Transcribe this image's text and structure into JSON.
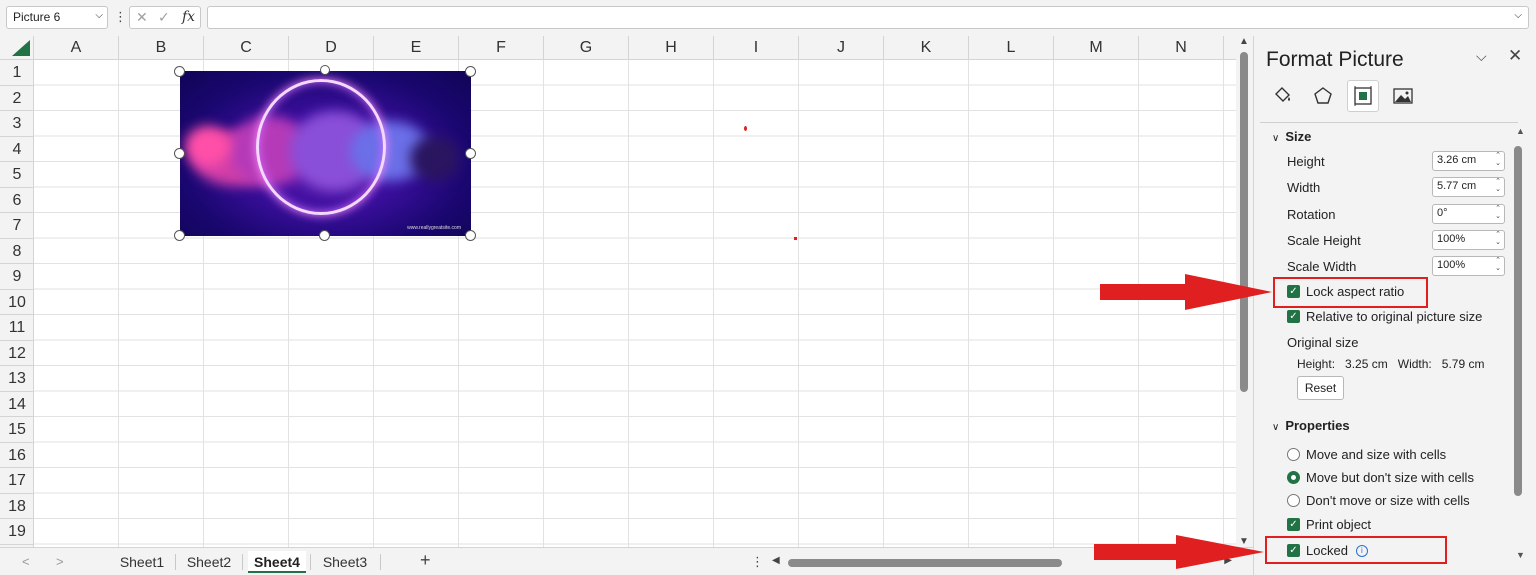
{
  "formula_bar": {
    "name_box": "Picture 6",
    "formula_value": ""
  },
  "columns": [
    "A",
    "B",
    "C",
    "D",
    "E",
    "F",
    "G",
    "H",
    "I",
    "J",
    "K",
    "L",
    "M",
    "N"
  ],
  "rows": [
    "1",
    "2",
    "3",
    "4",
    "5",
    "6",
    "7",
    "8",
    "9",
    "10",
    "11",
    "12",
    "13",
    "14",
    "15",
    "16",
    "17",
    "18",
    "19"
  ],
  "picture": {
    "watermark": "www.reallygreatsite.com"
  },
  "sheet_tabs": {
    "tabs": [
      "Sheet1",
      "Sheet2",
      "Sheet4",
      "Sheet3"
    ],
    "active": "Sheet4",
    "add_label": "+"
  },
  "panel": {
    "title": "Format Picture",
    "size_section": {
      "header": "Size",
      "height_label": "Height",
      "height_value": "3.26 cm",
      "width_label": "Width",
      "width_value": "5.77 cm",
      "rotation_label": "Rotation",
      "rotation_value": "0°",
      "scale_height_label": "Scale Height",
      "scale_height_value": "100%",
      "scale_width_label": "Scale Width",
      "scale_width_value": "100%",
      "lock_aspect_label": "Lock aspect ratio",
      "lock_aspect_checked": true,
      "relative_label": "Relative to original picture size",
      "relative_checked": true,
      "original_size_label": "Original size",
      "original_height_label": "Height:",
      "original_height_value": "3.25 cm",
      "original_width_label": "Width:",
      "original_width_value": "5.79 cm",
      "reset_label": "Reset"
    },
    "properties_section": {
      "header": "Properties",
      "option_move_size": "Move and size with cells",
      "option_move_only": "Move but don't size with cells",
      "option_none": "Don't move or size with cells",
      "selected_option": "Move but don't size with cells",
      "print_object_label": "Print object",
      "print_object_checked": true,
      "locked_label": "Locked",
      "locked_checked": true
    }
  },
  "colors": {
    "accent": "#217346",
    "annotation_red": "#e02020"
  }
}
